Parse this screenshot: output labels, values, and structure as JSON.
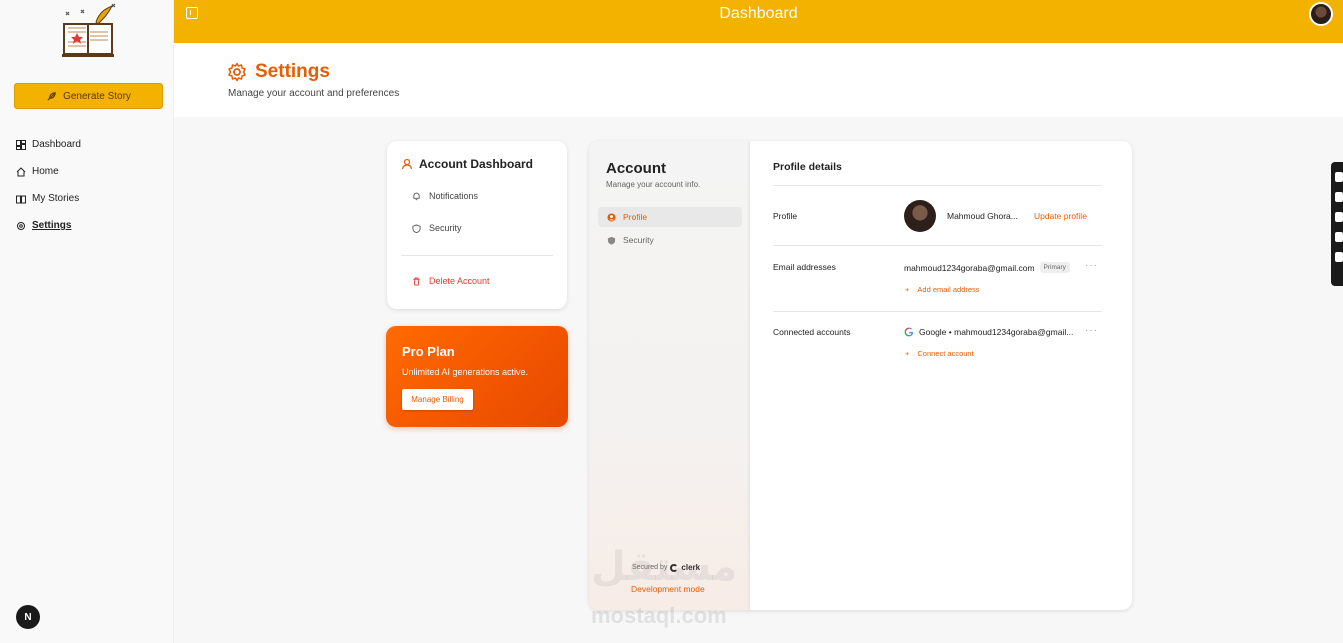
{
  "sidebar": {
    "generate_label": "Generate Story",
    "items": [
      {
        "label": "Dashboard",
        "icon": "dashboard-icon"
      },
      {
        "label": "Home",
        "icon": "home-icon"
      },
      {
        "label": "My Stories",
        "icon": "book-icon"
      },
      {
        "label": "Settings",
        "icon": "gear-icon"
      }
    ],
    "next_badge": "N"
  },
  "topbar": {
    "title": "Dashboard"
  },
  "header": {
    "title": "Settings",
    "subtitle": "Manage your account and preferences"
  },
  "account_card": {
    "title": "Account Dashboard",
    "items": [
      "Notifications",
      "Security"
    ],
    "delete_label": "Delete Account"
  },
  "pro_card": {
    "title": "Pro Plan",
    "subtitle": "Unlimited AI generations active.",
    "billing_label": "Manage Billing"
  },
  "clerk": {
    "title": "Account",
    "subtitle": "Manage your account info.",
    "nav": [
      "Profile",
      "Security"
    ],
    "secured_by": "Secured by",
    "brand": "clerk",
    "dev_mode": "Development mode",
    "profile_details": "Profile details",
    "rows": {
      "profile_label": "Profile",
      "profile_name": "Mahmoud Ghora...",
      "update_profile": "Update profile",
      "email_label": "Email addresses",
      "email_value": "mahmoud1234goraba@gmail.com",
      "email_badge": "Primary",
      "add_email": "Add email address",
      "connected_label": "Connected accounts",
      "connected_value": "Google • mahmoud1234goraba@gmail...",
      "connect_account": "Connect account",
      "more": "···"
    }
  },
  "watermark": {
    "arabic": "مستقل",
    "latin": "mostaql.com"
  },
  "colors": {
    "accent": "#e85d04",
    "topbar": "#f3b100"
  }
}
